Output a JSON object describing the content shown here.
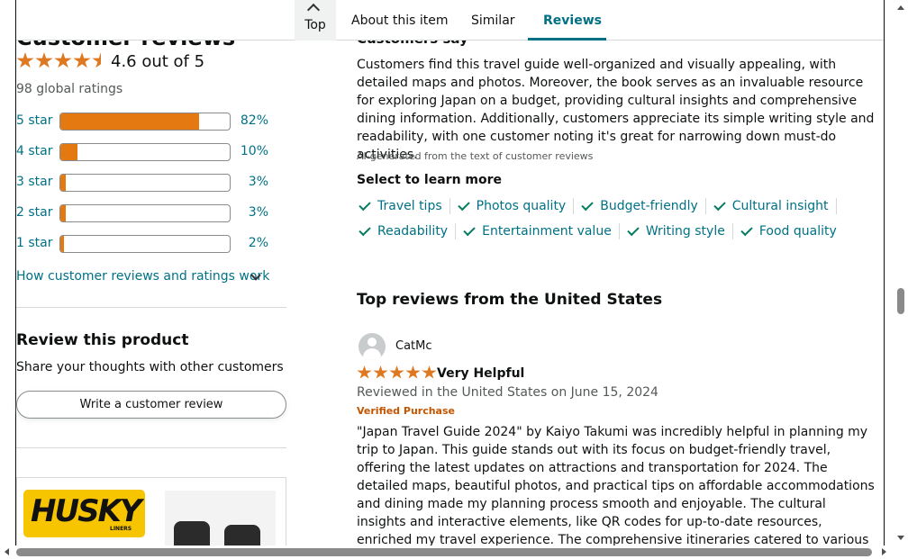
{
  "tabs": {
    "top_label": "Top",
    "about": "About this item",
    "similar": "Similar",
    "reviews": "Reviews"
  },
  "ratings": {
    "cut_title": "Customer reviews",
    "average": 4.6,
    "rating_text": "4.6 out of 5",
    "global_ratings": "98 global ratings",
    "histogram": [
      {
        "label": "5 star",
        "percent": 82,
        "percent_text": "82%"
      },
      {
        "label": "4 star",
        "percent": 10,
        "percent_text": "10%"
      },
      {
        "label": "3 star",
        "percent": 3,
        "percent_text": "3%"
      },
      {
        "label": "2 star",
        "percent": 3,
        "percent_text": "3%"
      },
      {
        "label": "1 star",
        "percent": 2,
        "percent_text": "2%"
      }
    ],
    "how_link": "How customer reviews and ratings work"
  },
  "review_product": {
    "heading": "Review this product",
    "subtext": "Share your thoughts with other customers",
    "button": "Write a customer review"
  },
  "ad": {
    "brand": "HUSKY",
    "brand_sub": "LINERS"
  },
  "summary": {
    "cut_heading": "Customers say",
    "text": "Customers find this travel guide well-organized and visually appealing, with detailed maps and photos. Moreover, the book serves as an invaluable resource for exploring Japan on a budget, providing cultural insights and comprehensive dining information. Additionally, customers appreciate its simple writing style and readability, with one customer noting it's great for narrowing down must-do activities.",
    "ai_note": "AI-generated from the text of customer reviews",
    "select_heading": "Select to learn more",
    "aspects_row1": [
      "Travel tips",
      "Photos quality",
      "Budget-friendly",
      "Cultural insight"
    ],
    "aspects_row2": [
      "Readability",
      "Entertainment value",
      "Writing style",
      "Food quality"
    ]
  },
  "top_reviews": {
    "heading": "Top reviews from the United States",
    "review": {
      "reviewer": "CatMc",
      "stars": 5,
      "title": "Very Helpful",
      "date": "Reviewed in the United States on June 15, 2024",
      "verified": "Verified Purchase",
      "body": "\"Japan Travel Guide 2024\" by Kaiyo Takumi was incredibly helpful in planning my trip to Japan. This guide stands out with its focus on budget-friendly travel, offering the latest updates on attractions and transportation for 2024. The detailed maps, beautiful photos, and practical tips on affordable accommodations and dining made my planning process smooth and enjoyable. The cultural insights and interactive elements, like QR codes for up-to-date resources, enriched my travel experience. The comprehensive itineraries catered to various trip lengths, ensuring I made the most of my time. This guide is an essential"
    }
  },
  "colors": {
    "star": "#de7921",
    "link": "#007185",
    "bar_fill": "#e47911",
    "verified": "#c45500",
    "check": "#067d62"
  }
}
